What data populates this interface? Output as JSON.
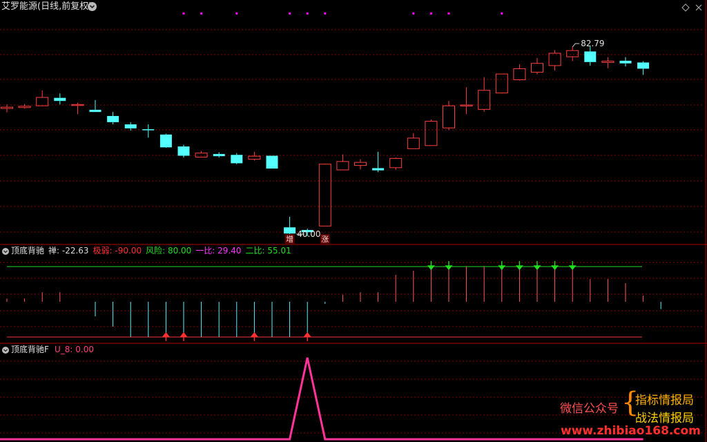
{
  "main_panel": {
    "title": "艾罗能源(日线,前复权)",
    "dropdown_icon": "chevron-down-icon",
    "corner_icons": [
      "diamond-icon",
      "close-icon"
    ],
    "high_label": "82.79",
    "low_label": "40.00",
    "marker_zeng": "增",
    "marker_zhang": "涨",
    "colors": {
      "up": "#ff4040",
      "down": "#54ffff",
      "dot": "#ff00ff",
      "grid": "#8b0000"
    }
  },
  "indicator_panel": {
    "title": "顶底背驰",
    "items": [
      {
        "label": "禅: -22.63",
        "color": "#dcdcdc"
      },
      {
        "label": "极弱: -90.00",
        "color": "#ff3030"
      },
      {
        "label": "风险: 80.00",
        "color": "#22dd22"
      },
      {
        "label": "一比: 29.40",
        "color": "#ff33ff"
      },
      {
        "label": "二比: 55.01",
        "color": "#22dd22"
      }
    ]
  },
  "f_panel": {
    "title": "顶底背驰F",
    "value_label": "U_8: 0.00",
    "value_color": "#ff4080"
  },
  "watermark": {
    "wechat": "微信公众号",
    "line1": "指标情报局",
    "line2": "战法情报局",
    "url": "www.zhibiao168.com"
  },
  "chart_data": [
    {
      "type": "candlestick",
      "title": "艾罗能源(日线,前复权)",
      "ylim": [
        40,
        90
      ],
      "grid": true,
      "annotations": [
        {
          "text": "82.79",
          "candle_index": 32
        },
        {
          "text": "40.00",
          "candle_index": 17
        },
        {
          "text": "增",
          "candle_index": 16
        },
        {
          "text": "涨",
          "candle_index": 18
        }
      ],
      "dot_markers_at_candles": [
        10,
        11,
        13,
        16,
        17,
        18,
        23,
        24,
        25,
        28
      ],
      "candles": [
        {
          "open": 68.9,
          "close": 69.2,
          "high": 69.8,
          "low": 68.0
        },
        {
          "open": 69.1,
          "close": 69.4,
          "high": 69.9,
          "low": 68.9
        },
        {
          "open": 69.5,
          "close": 71.4,
          "high": 73.0,
          "low": 69.5
        },
        {
          "open": 71.3,
          "close": 70.6,
          "high": 72.3,
          "low": 69.8
        },
        {
          "open": 69.6,
          "close": 69.8,
          "high": 70.2,
          "low": 67.6
        },
        {
          "open": 68.6,
          "close": 68.1,
          "high": 70.8,
          "low": 68.1
        },
        {
          "open": 67.2,
          "close": 65.8,
          "high": 68.1,
          "low": 65.3
        },
        {
          "open": 65.3,
          "close": 64.4,
          "high": 65.8,
          "low": 63.9
        },
        {
          "open": 64.2,
          "close": 64.0,
          "high": 65.3,
          "low": 62.3
        },
        {
          "open": 63.0,
          "close": 60.1,
          "high": 63.2,
          "low": 60.0
        },
        {
          "open": 60.3,
          "close": 58.2,
          "high": 60.7,
          "low": 57.8
        },
        {
          "open": 57.9,
          "close": 58.8,
          "high": 59.3,
          "low": 57.8
        },
        {
          "open": 58.6,
          "close": 58.1,
          "high": 59.0,
          "low": 57.8
        },
        {
          "open": 58.4,
          "close": 56.5,
          "high": 58.8,
          "low": 56.3
        },
        {
          "open": 57.4,
          "close": 58.1,
          "high": 59.1,
          "low": 57.1
        },
        {
          "open": 58.2,
          "close": 55.3,
          "high": 58.2,
          "low": 55.3
        },
        {
          "open": 42.0,
          "close": 40.6,
          "high": 44.4,
          "low": 40.0
        },
        {
          "open": 41.4,
          "close": 40.9,
          "high": 41.7,
          "low": 40.0
        },
        {
          "open": 42.3,
          "close": 56.3,
          "high": 56.4,
          "low": 42.3
        },
        {
          "open": 55.0,
          "close": 56.9,
          "high": 58.5,
          "low": 55.0
        },
        {
          "open": 56.0,
          "close": 56.7,
          "high": 57.4,
          "low": 55.1
        },
        {
          "open": 55.4,
          "close": 54.9,
          "high": 59.1,
          "low": 54.5
        },
        {
          "open": 55.5,
          "close": 57.6,
          "high": 57.8,
          "low": 55.0
        },
        {
          "open": 59.8,
          "close": 62.2,
          "high": 63.3,
          "low": 59.8
        },
        {
          "open": 60.5,
          "close": 66.0,
          "high": 66.4,
          "low": 60.5
        },
        {
          "open": 64.5,
          "close": 69.5,
          "high": 70.6,
          "low": 64.0
        },
        {
          "open": 69.5,
          "close": 69.7,
          "high": 73.7,
          "low": 67.6
        },
        {
          "open": 68.7,
          "close": 73.0,
          "high": 76.0,
          "low": 68.2
        },
        {
          "open": 72.4,
          "close": 76.7,
          "high": 76.7,
          "low": 72.3
        },
        {
          "open": 75.4,
          "close": 77.9,
          "high": 78.9,
          "low": 75.2
        },
        {
          "open": 77.1,
          "close": 79.1,
          "high": 80.3,
          "low": 76.6
        },
        {
          "open": 78.6,
          "close": 81.4,
          "high": 82.1,
          "low": 77.5
        },
        {
          "open": 80.6,
          "close": 82.0,
          "high": 82.8,
          "low": 79.6
        },
        {
          "open": 81.8,
          "close": 79.4,
          "high": 83.0,
          "low": 78.6
        },
        {
          "open": 79.3,
          "close": 79.6,
          "high": 80.5,
          "low": 78.0
        },
        {
          "open": 79.7,
          "close": 79.1,
          "high": 80.5,
          "low": 78.4
        },
        {
          "open": 79.3,
          "close": 77.9,
          "high": 79.6,
          "low": 76.5
        }
      ]
    },
    {
      "type": "bar",
      "title": "顶底背驰",
      "ylim": [
        -90,
        80
      ],
      "reference_lines": [
        {
          "name": "风险",
          "value": 80,
          "color": "#22dd22"
        },
        {
          "name": "极弱",
          "value": -90,
          "color": "#ff3030"
        }
      ],
      "series": [
        {
          "values": [
            3,
            3,
            18,
            18,
            0,
            -40,
            -65,
            -90,
            -90,
            -90,
            -90,
            -90,
            -90,
            -90,
            -90,
            -90,
            -90,
            -90,
            -10,
            12,
            18,
            18,
            60,
            70,
            80,
            80,
            80,
            80,
            80,
            80,
            80,
            80,
            80,
            50,
            50,
            40,
            10,
            -22.63
          ]
        }
      ],
      "up_arrows_at": [
        9,
        10,
        14,
        17
      ],
      "down_arrows_at": [
        24,
        25,
        28,
        29,
        30,
        31,
        32
      ]
    },
    {
      "type": "line",
      "title": "顶底背驰F",
      "series": [
        {
          "name": "U_8",
          "values": [
            0,
            0,
            0,
            0,
            0,
            0,
            0,
            0,
            0,
            0,
            0,
            0,
            0,
            0,
            0,
            0,
            0,
            1,
            0,
            0,
            0,
            0,
            0,
            0,
            0,
            0,
            0,
            0,
            0,
            0,
            0,
            0,
            0,
            0,
            0,
            0,
            0
          ]
        }
      ]
    }
  ]
}
